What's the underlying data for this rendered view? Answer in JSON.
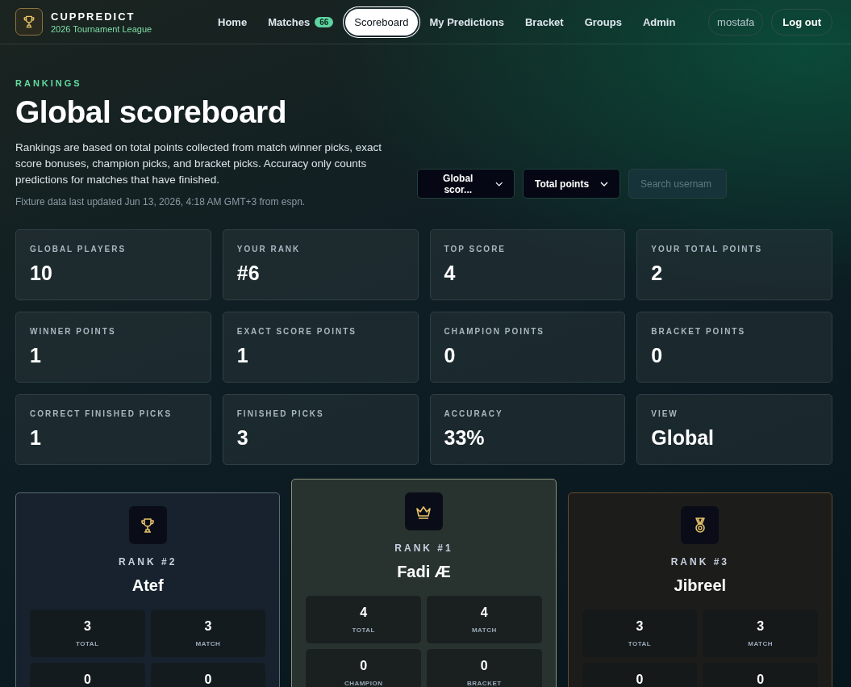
{
  "brand": {
    "title": "CUPPREDICT",
    "subtitle": "2026 Tournament League"
  },
  "nav": [
    {
      "label": "Home",
      "selected": false
    },
    {
      "label": "Matches",
      "selected": false,
      "badge": "66"
    },
    {
      "label": "Scoreboard",
      "selected": true
    },
    {
      "label": "My Predictions",
      "selected": false
    },
    {
      "label": "Bracket",
      "selected": false
    },
    {
      "label": "Groups",
      "selected": false
    },
    {
      "label": "Admin",
      "selected": false
    }
  ],
  "user": {
    "name": "mostafa",
    "logout": "Log out"
  },
  "header": {
    "eyebrow": "RANKINGS",
    "title": "Global scoreboard",
    "description": "Rankings are based on total points collected from match winner picks, exact score bonuses, champion picks, and bracket picks. Accuracy only counts predictions for matches that have finished.",
    "updated": "Fixture data last updated Jun 13, 2026, 4:18 AM GMT+3 from espn."
  },
  "filters": {
    "scope": "Global scor...",
    "sort": "Total points",
    "search_placeholder": "Search usernam"
  },
  "stats": [
    {
      "label": "GLOBAL PLAYERS",
      "value": "10"
    },
    {
      "label": "YOUR RANK",
      "value": "#6"
    },
    {
      "label": "TOP SCORE",
      "value": "4"
    },
    {
      "label": "YOUR TOTAL POINTS",
      "value": "2"
    },
    {
      "label": "WINNER POINTS",
      "value": "1"
    },
    {
      "label": "EXACT SCORE POINTS",
      "value": "1"
    },
    {
      "label": "CHAMPION POINTS",
      "value": "0"
    },
    {
      "label": "BRACKET POINTS",
      "value": "0"
    },
    {
      "label": "CORRECT FINISHED PICKS",
      "value": "1"
    },
    {
      "label": "FINISHED PICKS",
      "value": "3"
    },
    {
      "label": "ACCURACY",
      "value": "33%"
    },
    {
      "label": "VIEW",
      "value": "Global"
    }
  ],
  "podium": [
    {
      "kind": "second",
      "rank": "RANK #2",
      "name": "Atef",
      "stats": [
        {
          "value": "3",
          "label": "TOTAL"
        },
        {
          "value": "3",
          "label": "MATCH"
        },
        {
          "value": "0"
        },
        {
          "value": "0"
        }
      ]
    },
    {
      "kind": "first",
      "rank": "RANK #1",
      "name": "Fadi Æ",
      "stats": [
        {
          "value": "4",
          "label": "TOTAL"
        },
        {
          "value": "4",
          "label": "MATCH"
        },
        {
          "value": "0",
          "label": "CHAMPION"
        },
        {
          "value": "0",
          "label": "BRACKET"
        }
      ]
    },
    {
      "kind": "third",
      "rank": "RANK #3",
      "name": "Jibreel",
      "stats": [
        {
          "value": "3",
          "label": "TOTAL"
        },
        {
          "value": "3",
          "label": "MATCH"
        },
        {
          "value": "0"
        },
        {
          "value": "0"
        }
      ]
    }
  ]
}
